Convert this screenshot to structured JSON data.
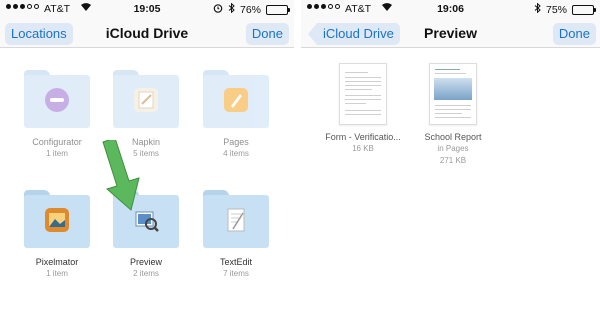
{
  "left_screen": {
    "status": {
      "carrier": "AT&T",
      "time": "19:05",
      "battery": "76%",
      "battery_level": 0.76
    },
    "nav": {
      "back_label": "Locations",
      "title": "iCloud Drive",
      "done_label": "Done"
    },
    "folders": [
      {
        "name": "Configurator",
        "count": "1 item"
      },
      {
        "name": "Napkin",
        "count": "5 items"
      },
      {
        "name": "Pages",
        "count": "4 items"
      },
      {
        "name": "Pixelmator",
        "count": "1 item"
      },
      {
        "name": "Preview",
        "count": "2 items"
      },
      {
        "name": "TextEdit",
        "count": "7 items"
      }
    ]
  },
  "right_screen": {
    "status": {
      "carrier": "AT&T",
      "time": "19:06",
      "battery": "75%",
      "battery_level": 0.75
    },
    "nav": {
      "back_label": "iCloud Drive",
      "title": "Preview",
      "done_label": "Done"
    },
    "documents": [
      {
        "name": "Form - Verificatio...",
        "size": "16 KB",
        "location": ""
      },
      {
        "name": "School Report",
        "location": "in Pages",
        "size": "271 KB"
      }
    ]
  },
  "colors": {
    "accent": "#1a73c7",
    "folder": "#c7e0f4",
    "arrow": "#5cb85c"
  }
}
